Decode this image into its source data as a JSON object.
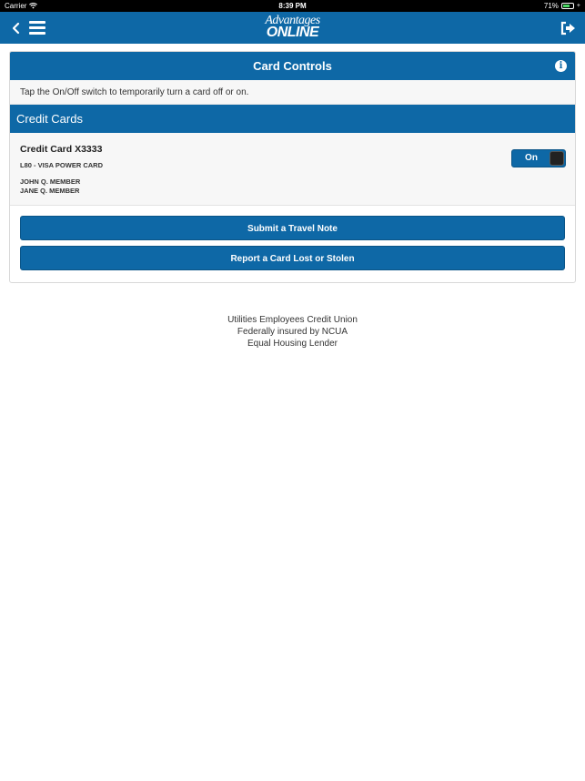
{
  "status_bar": {
    "carrier": "Carrier",
    "time": "8:39 PM",
    "battery": "71%",
    "battery_level": 0.71
  },
  "nav": {
    "logo_top": "Advantages",
    "logo_bottom": "ONLINE",
    "icons": [
      "back-arrow-icon",
      "hamburger-menu-icon",
      "logout-icon"
    ],
    "accent_color": "#0e68a6"
  },
  "panel": {
    "title": "Card Controls",
    "intro": "Tap the On/Off switch to temporarily turn a card off or on.",
    "section_title": "Credit Cards",
    "card": {
      "title": "Credit Card X3333",
      "type": "L80 - VISA POWER CARD",
      "holders": [
        "JOHN Q. MEMBER",
        "JANE Q. MEMBER"
      ],
      "toggle_label": "On"
    },
    "buttons": {
      "travel_note": "Submit a Travel Note",
      "lost_stolen": "Report a Card Lost or Stolen"
    }
  },
  "footer": {
    "line1": "Utilities Employees Credit Union",
    "line2": "Federally insured by NCUA",
    "line3": "Equal Housing Lender"
  }
}
